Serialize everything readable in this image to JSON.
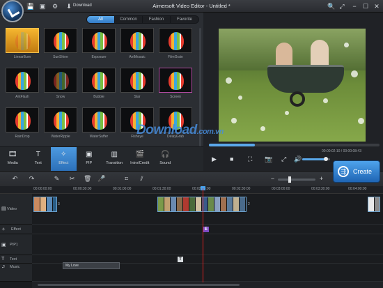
{
  "titlebar": {
    "download_label": "Download",
    "title": "Aimersoft Video Editor - Untitled *"
  },
  "filter_tabs": [
    "All",
    "Common",
    "Fashion",
    "Favorite"
  ],
  "effects": [
    "LinearBurn",
    "SunShine",
    "Exposure",
    "AntMosaic",
    "FilmGrain",
    "AntFlash",
    "Snow",
    "Bubble",
    "Star",
    "Screen",
    "RainDrop",
    "WaterRipple",
    "WaterSuffer",
    "Fisheye",
    "DelayGrab"
  ],
  "bottom_tabs": [
    {
      "label": "Media",
      "icon": "film-icon"
    },
    {
      "label": "Text",
      "icon": "text-icon"
    },
    {
      "label": "Effect",
      "icon": "magic-wand-icon"
    },
    {
      "label": "PIP",
      "icon": "pip-icon"
    },
    {
      "label": "Transition",
      "icon": "transition-icon"
    },
    {
      "label": "Intro/Credit",
      "icon": "clapper-icon"
    },
    {
      "label": "Sound",
      "icon": "headphones-icon"
    }
  ],
  "preview": {
    "timecode": "00:00:02:10 / 00:00:08:43",
    "progress": 0.27,
    "volume": 0.85
  },
  "create_button": "Create",
  "ruler_ticks": [
    "00:00:00:00",
    "00:00:30:00",
    "00:01:00:00",
    "00:01:30:00",
    "00:02:00:00",
    "00:02:30:00",
    "00:03:00:00",
    "00:03:30:00",
    "00:04:00:00"
  ],
  "tracks": {
    "video": "Video",
    "effect": "Effect",
    "pip": "PIP1",
    "text": "Text",
    "music": "Music"
  },
  "clips": {
    "clip1_count": "3",
    "clip2_count": "2",
    "effect_marker": "E",
    "text_marker": "T",
    "music_name": "My Love"
  },
  "watermark": {
    "main": "Download",
    "suffix": ".com.vn"
  },
  "colors": {
    "accent": "#2f76c2",
    "playhead": "#e02020",
    "effect_marker": "#7d4bc2"
  }
}
